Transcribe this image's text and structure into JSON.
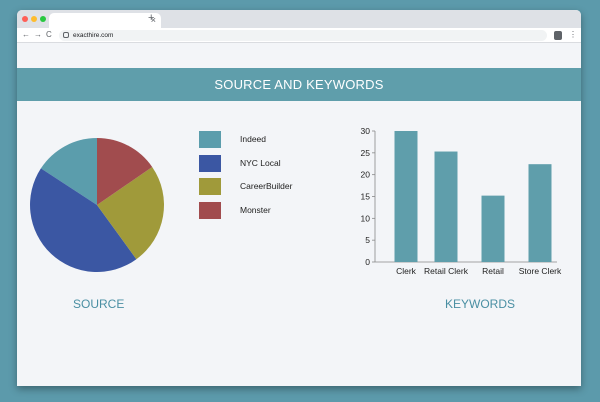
{
  "browser": {
    "tab_close": "×",
    "new_tab": "+",
    "url": "exacthire.com",
    "nav": {
      "back": "←",
      "forward": "→",
      "reload": "C"
    },
    "menu": "⋮",
    "traffic_lights": [
      "#ff5f57",
      "#febc2e",
      "#28c840"
    ]
  },
  "page": {
    "banner_title": "SOURCE AND KEYWORDS",
    "source_caption": "SOURCE",
    "keywords_caption": "KEYWORDS",
    "accent_color": "#5f9eab"
  },
  "legend": [
    {
      "label": "Indeed",
      "color": "#5b9dac"
    },
    {
      "label": "NYC Local",
      "color": "#3b57a3"
    },
    {
      "label": "CareerBuilder",
      "color": "#a09a3a"
    },
    {
      "label": "Monster",
      "color": "#a14c4e"
    }
  ],
  "chart_data": [
    {
      "type": "pie",
      "title": "",
      "categories": [
        "Indeed",
        "NYC Local",
        "CareerBuilder",
        "Monster"
      ],
      "values": [
        15.8,
        44.2,
        24.6,
        15.4
      ],
      "colors": [
        "#5b9dac",
        "#3b57a3",
        "#a09a3a",
        "#a14c4e"
      ],
      "legend_position": "right"
    },
    {
      "type": "bar",
      "title": "",
      "categories": [
        "Clerk",
        "Retail Clerk",
        "Retail",
        "Store Clerk"
      ],
      "values": [
        30,
        25.3,
        15.2,
        22.4
      ],
      "xlabel": "",
      "ylabel": "",
      "ylim": [
        0,
        30
      ],
      "yticks": [
        0,
        5,
        10,
        15,
        20,
        25,
        30
      ],
      "bar_color": "#5f9eab",
      "grid": false
    }
  ]
}
